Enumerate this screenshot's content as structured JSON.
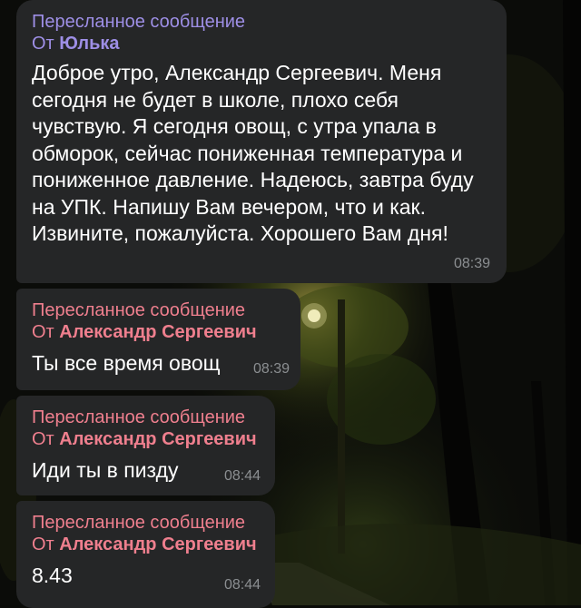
{
  "colors": {
    "bubble_bg": "#252627",
    "forward_accent_1": "#9e8fe6",
    "forward_accent_2": "#ef7f8e",
    "text": "#ffffff",
    "time": "#8b8e91"
  },
  "messages": [
    {
      "forward_label": "Пересланное сообщение",
      "from_prefix": "От",
      "from_name": "Юлька",
      "text": "Доброе утро, Александр Сергеевич. Меня сегодня не будет в школе, плохо себя чувствую. Я сегодня овощ, с утра упала в обморок, сейчас пониженная температура и пониженное давление. Надеюсь, завтра буду на УПК. Напишу Вам вечером, что и как. Извините, пожалуйста. Хорошего Вам дня!",
      "time": "08:39"
    },
    {
      "forward_label": "Пересланное сообщение",
      "from_prefix": "От",
      "from_name": "Александр Сергеевич",
      "text": "Ты все время овощ",
      "time": "08:39"
    },
    {
      "forward_label": "Пересланное сообщение",
      "from_prefix": "От",
      "from_name": "Александр Сергеевич",
      "text": "Иди ты в пизду",
      "time": "08:44"
    },
    {
      "forward_label": "Пересланное сообщение",
      "from_prefix": "От",
      "from_name": "Александр Сергеевич",
      "text": "8.43",
      "time": "08:44"
    }
  ]
}
